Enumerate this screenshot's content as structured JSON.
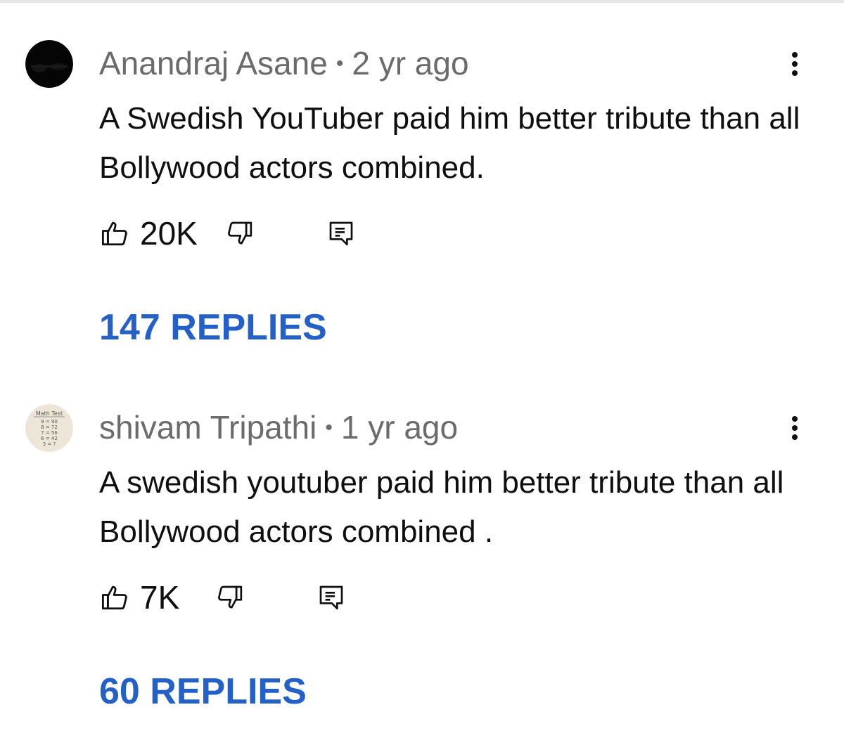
{
  "comments": [
    {
      "author": "Anandraj Asane",
      "separator": "•",
      "age": "2 yr ago",
      "text": "A Swedish YouTuber paid him better tribute than all Bollywood actors combined.",
      "likes": "20K",
      "replies": "147 REPLIES",
      "avatar": "dark-photo-avatar"
    },
    {
      "author": "shivam Tripathi",
      "separator": "•",
      "age": "1 yr ago",
      "text": "A swedish youtuber paid him better tribute than all Bollywood actors combined .",
      "likes": "7K",
      "replies": "60 REPLIES",
      "avatar": "math-test-avatar",
      "avatar_text": [
        "Math Test",
        "9 = 90",
        "8 = 72",
        "7 = 56",
        "6 = 42",
        "3 = ?"
      ]
    }
  ],
  "icons": {
    "like": "thumbs-up-icon",
    "dislike": "thumbs-down-icon",
    "reply": "reply-comment-icon",
    "menu": "more-vert-icon"
  },
  "colors": {
    "replies_link": "#2360c8",
    "meta_text": "#6b6b6b",
    "body_text": "#0f0f0f"
  }
}
